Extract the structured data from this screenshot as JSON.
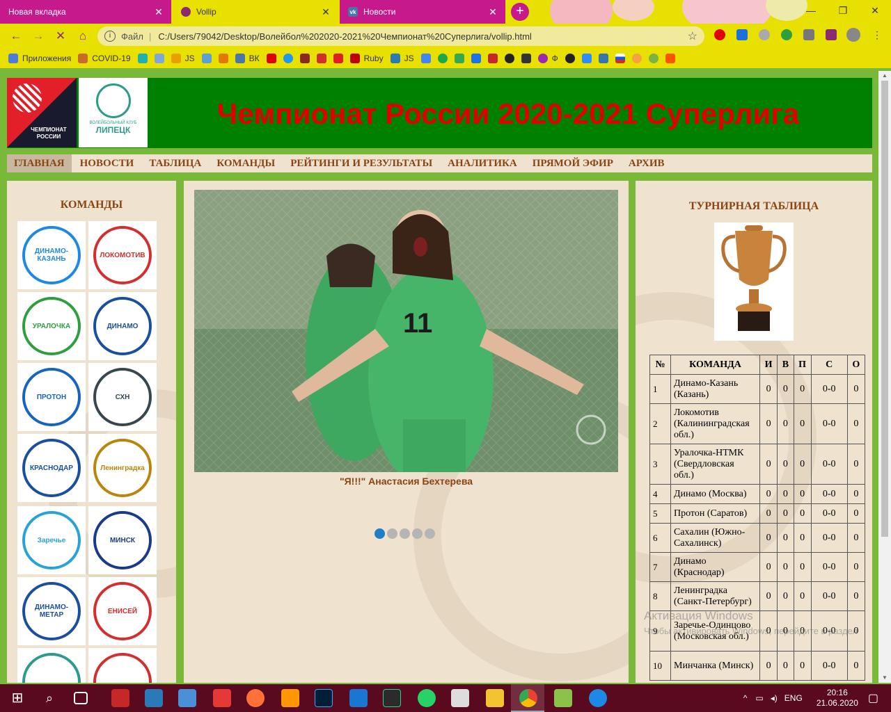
{
  "browser": {
    "tabs": [
      {
        "title": "Новая вкладка",
        "color": "#c5198c"
      },
      {
        "title": "Vollip",
        "color": "#e8e000"
      },
      {
        "title": "Новости",
        "color": "#c5198c"
      }
    ],
    "url_scheme": "Файл",
    "url": "C:/Users/79042/Desktop/Волейбол%202020-2021%20Чемпионат%20Суперлига/vollip.html",
    "bookmarks": [
      {
        "label": "Приложения",
        "icon": "apps-grid-icon"
      },
      {
        "label": "COVID-19",
        "icon": "covid-icon"
      },
      {
        "label": "",
        "icon": "bookmark-icon"
      },
      {
        "label": "",
        "icon": "bookmark-icon"
      },
      {
        "label": "JS",
        "icon": "js-icon"
      },
      {
        "label": "",
        "icon": "bookmark-icon"
      },
      {
        "label": "",
        "icon": "bookmark-icon"
      },
      {
        "label": "ВК",
        "icon": "vk-icon"
      },
      {
        "label": "",
        "icon": "youtube-icon"
      },
      {
        "label": "",
        "icon": "bookmark-icon"
      },
      {
        "label": "",
        "icon": "bookmark-icon"
      },
      {
        "label": "",
        "icon": "bookmark-icon"
      },
      {
        "label": "",
        "icon": "bookmark-icon"
      },
      {
        "label": "Ruby",
        "icon": "ruby-icon"
      },
      {
        "label": "JS",
        "icon": "js-icon"
      },
      {
        "label": "",
        "icon": "translate-icon"
      },
      {
        "label": "Ф",
        "icon": "bookmark-icon"
      }
    ]
  },
  "site": {
    "logo_text": "ЧЕМПИОНАТ РОССИИ",
    "club_small": "ВОЛЕЙБОЛЬНЫЙ КЛУБ",
    "club_big": "ЛИПЕЦК",
    "title": "Чемпионат России 2020-2021 Суперлига"
  },
  "menu": [
    "ГЛАВНАЯ",
    "НОВОСТИ",
    "ТАБЛИЦА",
    "КОМАНДЫ",
    "РЕЙТИНГИ И РЕЗУЛЬТАТЫ",
    "АНАЛИТИКА",
    "ПРЯМОЙ ЭФИР",
    "АРХИВ"
  ],
  "teams_title": "КОМАНДЫ",
  "team_logos": [
    {
      "name": "ДИНАМО-КАЗАНЬ",
      "color": "#1e88e5"
    },
    {
      "name": "ЛОКОМОТИВ",
      "color": "#d32f2f"
    },
    {
      "name": "УРАЛОЧКА",
      "color": "#2e9e3f"
    },
    {
      "name": "ДИНАМО",
      "color": "#1a4fa0"
    },
    {
      "name": "ПРОТОН",
      "color": "#1565c0"
    },
    {
      "name": "СХН",
      "color": "#37474f"
    },
    {
      "name": "КРАСНОДАР",
      "color": "#1a4fa0"
    },
    {
      "name": "Ленинградка",
      "color": "#b8860b"
    },
    {
      "name": "Заречье",
      "color": "#29a3d6"
    },
    {
      "name": "МИНСК",
      "color": "#1a3a8a"
    },
    {
      "name": "ДИНАМО-МЕТАР",
      "color": "#1a4fa0"
    },
    {
      "name": "ЕНИСЕЙ",
      "color": "#d32f2f"
    },
    {
      "name": "",
      "color": "#2d9b8a"
    },
    {
      "name": "",
      "color": "#d32f2f"
    }
  ],
  "slider": {
    "caption": "\"Я!!!\" Анастасия Бехтерева",
    "dots": 5,
    "active_dot": 0
  },
  "standings": {
    "title": "ТУРНИРНАЯ ТАБЛИЦА",
    "columns": [
      "№",
      "КОМАНДА",
      "И",
      "В",
      "П",
      "С",
      "О"
    ],
    "rows": [
      [
        "1",
        "Динамо-Казань (Казань)",
        "0",
        "0",
        "0",
        "0-0",
        "0"
      ],
      [
        "2",
        "Локомотив (Калининградская обл.)",
        "0",
        "0",
        "0",
        "0-0",
        "0"
      ],
      [
        "3",
        "Уралочка-НТМК (Свердловская обл.)",
        "0",
        "0",
        "0",
        "0-0",
        "0"
      ],
      [
        "4",
        "Динамо (Москва)",
        "0",
        "0",
        "0",
        "0-0",
        "0"
      ],
      [
        "5",
        "Протон (Саратов)",
        "0",
        "0",
        "0",
        "0-0",
        "0"
      ],
      [
        "6",
        "Сахалин (Южно-Сахалинск)",
        "0",
        "0",
        "0",
        "0-0",
        "0"
      ],
      [
        "7",
        "Динамо (Краснодар)",
        "0",
        "0",
        "0",
        "0-0",
        "0"
      ],
      [
        "8",
        "Ленинградка (Санкт-Петербург)",
        "0",
        "0",
        "0",
        "0-0",
        "0"
      ],
      [
        "9",
        "Заречье-Одинцово (Московская обл.)",
        "0",
        "0",
        "0",
        "0-0",
        "0"
      ],
      [
        "10",
        "Минчанка (Минск)",
        "0",
        "0",
        "0",
        "0-0",
        "0"
      ]
    ]
  },
  "watermark": {
    "line1": "Активация Windows",
    "line2": "Чтобы активировать Windows, перейдите в раздел"
  },
  "taskbar": {
    "lang": "ENG",
    "time": "20:16",
    "date": "21.06.2020"
  }
}
